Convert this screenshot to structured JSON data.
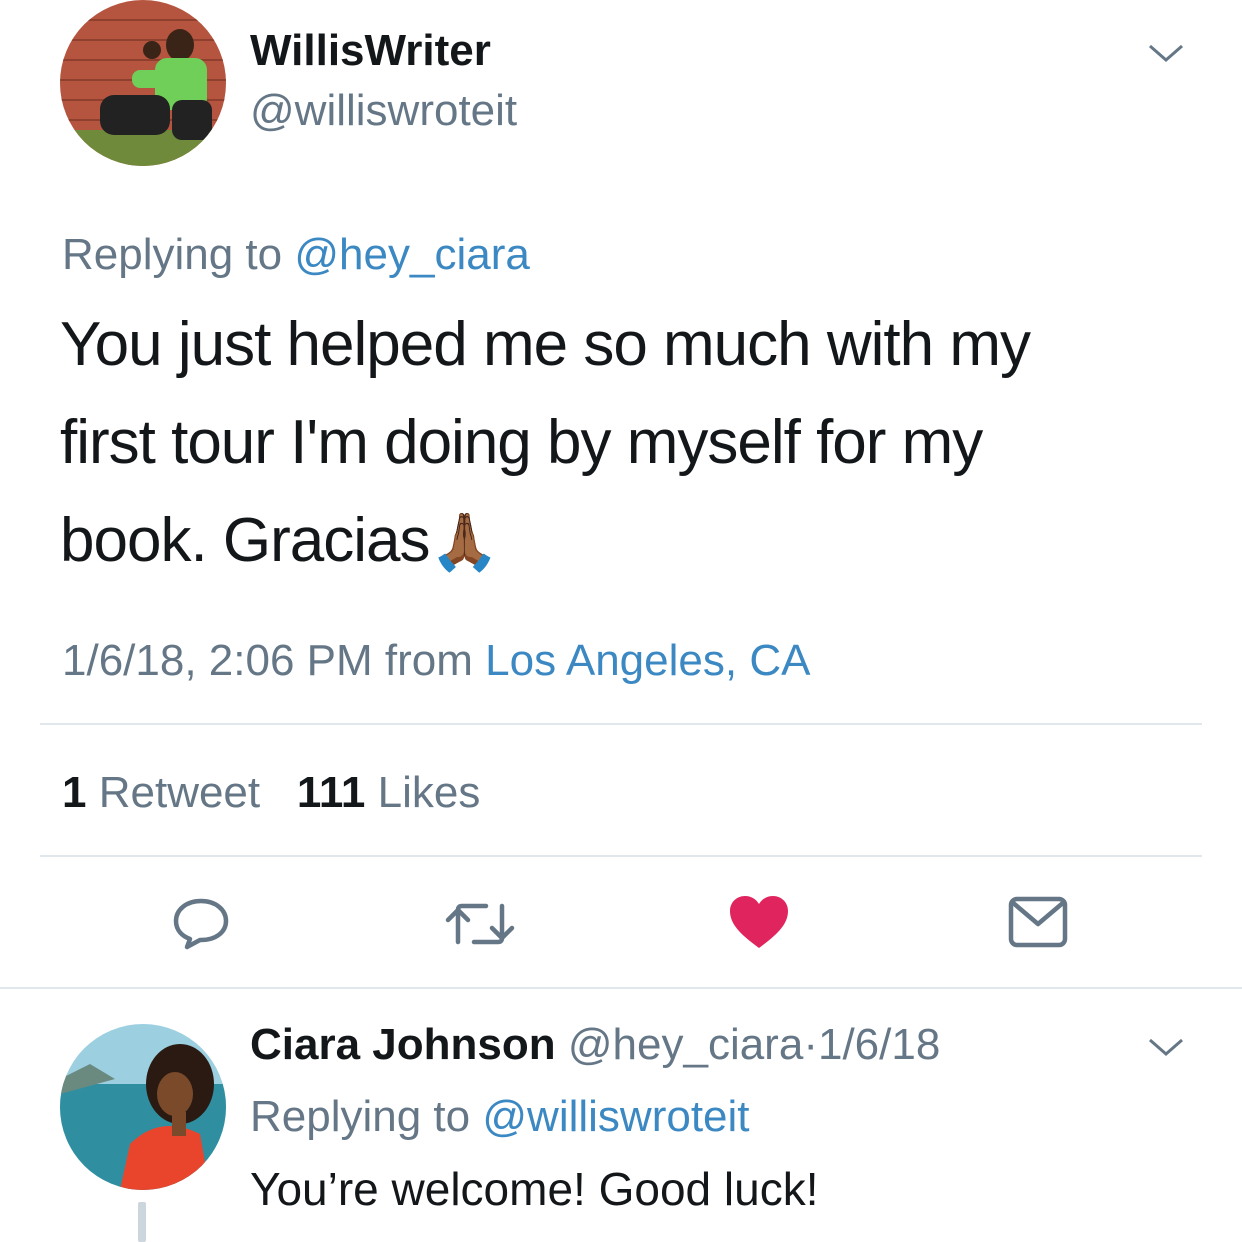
{
  "main_tweet": {
    "author_name": "WillisWriter",
    "author_handle": "@williswroteit",
    "replying_prefix": "Replying to",
    "replying_to": "@hey_ciara",
    "text_line1": "You just helped me so much with my",
    "text_line2": "first tour I'm doing by myself for my",
    "text_line3": "book. Gracias",
    "emoji": "🙏🏾",
    "timestamp": "1/6/18, 2:06 PM",
    "from_label": "from",
    "location": "Los Angeles, CA",
    "retweet_count": "1",
    "retweet_label": "Retweet",
    "like_count": "111",
    "like_label": "Likes"
  },
  "actions": {
    "reply_icon": "reply-bubble-icon",
    "retweet_icon": "retweet-icon",
    "like_icon": "heart-icon",
    "message_icon": "envelope-icon",
    "like_color": "#e0245e",
    "icon_color": "#657786"
  },
  "reply_tweet": {
    "author_name": "Ciara Johnson",
    "author_handle": "@hey_ciara",
    "separator": "·",
    "date": "1/6/18",
    "replying_prefix": "Replying to",
    "replying_to": "@williswroteit",
    "text": "You’re welcome! Good luck!"
  },
  "colors": {
    "link": "#3b88c3",
    "muted": "#657786",
    "divider": "#e1e8ed"
  }
}
